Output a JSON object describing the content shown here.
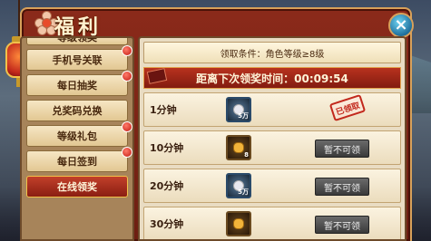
{
  "window": {
    "title": "福利",
    "close_label": "×"
  },
  "sidebar": {
    "items": [
      {
        "label": "等级领奖",
        "active": false,
        "badge": false,
        "partial": true
      },
      {
        "label": "手机号关联",
        "active": false,
        "badge": true
      },
      {
        "label": "每日抽奖",
        "active": false,
        "badge": true
      },
      {
        "label": "兑奖码兑换",
        "active": false,
        "badge": false
      },
      {
        "label": "等级礼包",
        "active": false,
        "badge": true
      },
      {
        "label": "每日签到",
        "active": false,
        "badge": true
      },
      {
        "label": "在线领奖",
        "active": true,
        "badge": false
      }
    ]
  },
  "panel": {
    "condition": "领取条件：角色等级≥8级",
    "timer_label": "距离下次领奖时间：00:09:54",
    "rows": [
      {
        "time": "1分钟",
        "icon": "silver-coin-icon",
        "icon_tag": "5万",
        "status": "claimed",
        "stamp": "已领取"
      },
      {
        "time": "10分钟",
        "icon": "gold-ingot-icon",
        "icon_tag": "8",
        "status": "locked",
        "button": "暂不可领"
      },
      {
        "time": "20分钟",
        "icon": "silver-coin-icon",
        "icon_tag": "5万",
        "status": "locked",
        "button": "暂不可领"
      },
      {
        "time": "30分钟",
        "icon": "gold-bar-icon",
        "icon_tag": "",
        "status": "locked",
        "button": "暂不可领"
      }
    ]
  },
  "colors": {
    "frame_red": "#8b2a1a",
    "frame_gold": "#d8a15a",
    "button_gray": "#4a4a4a",
    "close_blue": "#1f6f9c"
  }
}
